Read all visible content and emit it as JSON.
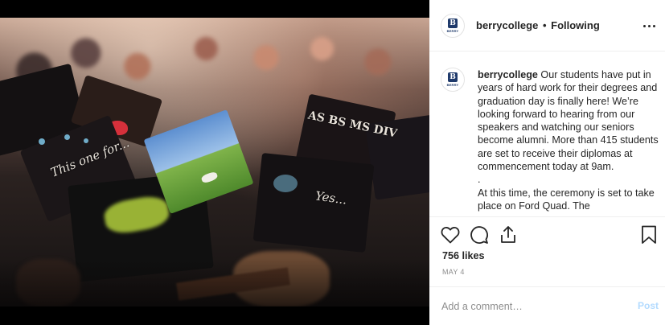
{
  "post": {
    "photo_alt": "Graduation caps at commencement",
    "cap_texts": [
      "This one for...",
      "AS BS MS DIV",
      "Yes..."
    ]
  },
  "account": {
    "logo_letter": "B",
    "logo_word": "BERRY"
  },
  "header": {
    "username": "berrycollege",
    "separator": "•",
    "follow_status": "Following"
  },
  "caption": {
    "username": "berrycollege",
    "text": "Our students have put in years of hard work for their degrees and graduation day is finally here! We’re looking forward to hearing from our speakers and watching our seniors become alumni. More than 415 students are set to receive their diplomas at commencement today at 9am.",
    "dot_line": ".",
    "text2": "At this time, the ceremony is set to take place on Ford Quad. The"
  },
  "actions": {
    "like_icon": "heart-icon",
    "comment_icon": "comment-icon",
    "share_icon": "share-icon",
    "save_icon": "bookmark-icon",
    "likes": "756 likes",
    "date": "MAY 4"
  },
  "comment": {
    "placeholder": "Add a comment…",
    "post_label": "Post"
  },
  "colors": {
    "brand_navy": "#1f3a6b",
    "post_button_disabled": "#b3dbff",
    "text": "#262626",
    "muted": "#8e8e8e"
  }
}
